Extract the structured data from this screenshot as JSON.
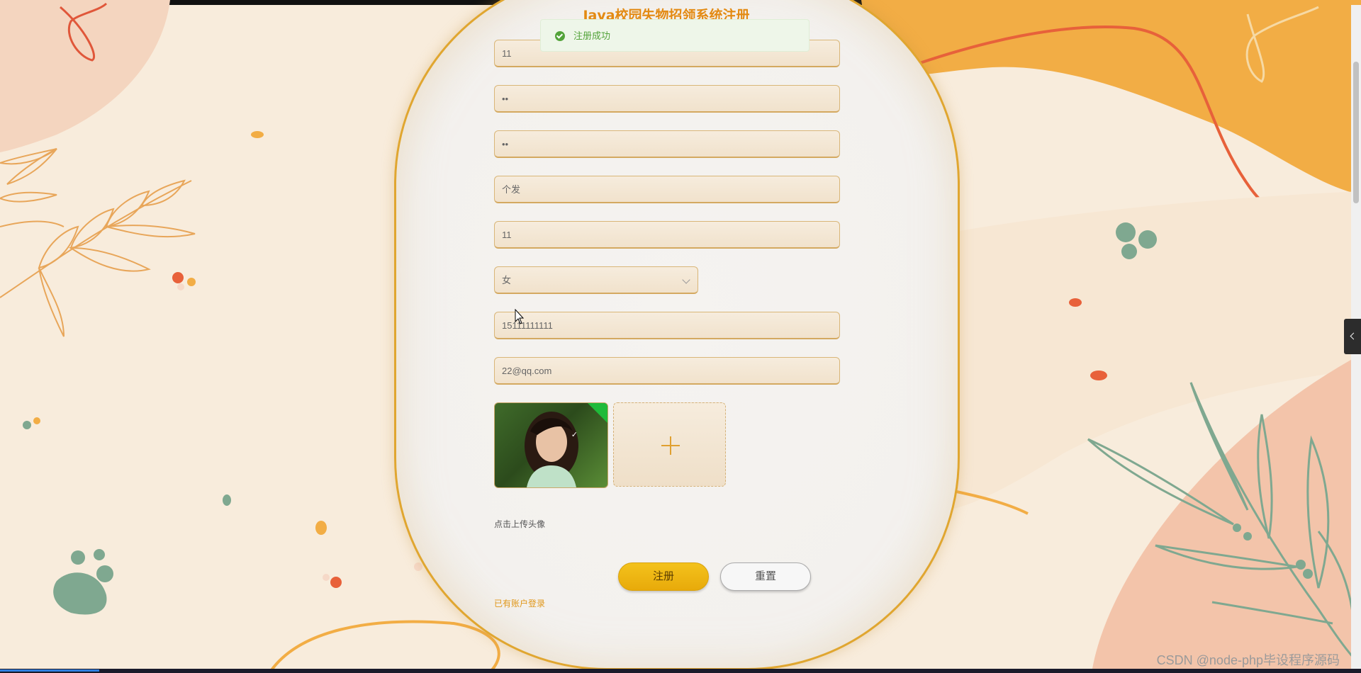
{
  "page": {
    "title": "Java校园失物招领系统注册",
    "toast": "注册成功",
    "watermark": "CSDN @node-php毕设程序源码"
  },
  "form": {
    "fields": [
      {
        "name": "account",
        "value": "11"
      },
      {
        "name": "password",
        "value": "••"
      },
      {
        "name": "confirm-password",
        "value": "••"
      },
      {
        "name": "name",
        "value": "个发"
      },
      {
        "name": "age",
        "value": "11"
      },
      {
        "name": "phone",
        "value": "15111111111"
      },
      {
        "name": "email",
        "value": "22@qq.com"
      }
    ],
    "gender": {
      "value": "女"
    },
    "avatar_hint": "点击上传头像",
    "register_label": "注册",
    "reset_label": "重置",
    "login_link": "已有账户登录"
  },
  "colors": {
    "accent": "#e38a12",
    "button": "#f3c21c",
    "success": "#53a33a"
  },
  "icons": [
    "success-check-icon",
    "chevron-down-icon",
    "plus-icon",
    "collapse-arrow-icon"
  ]
}
